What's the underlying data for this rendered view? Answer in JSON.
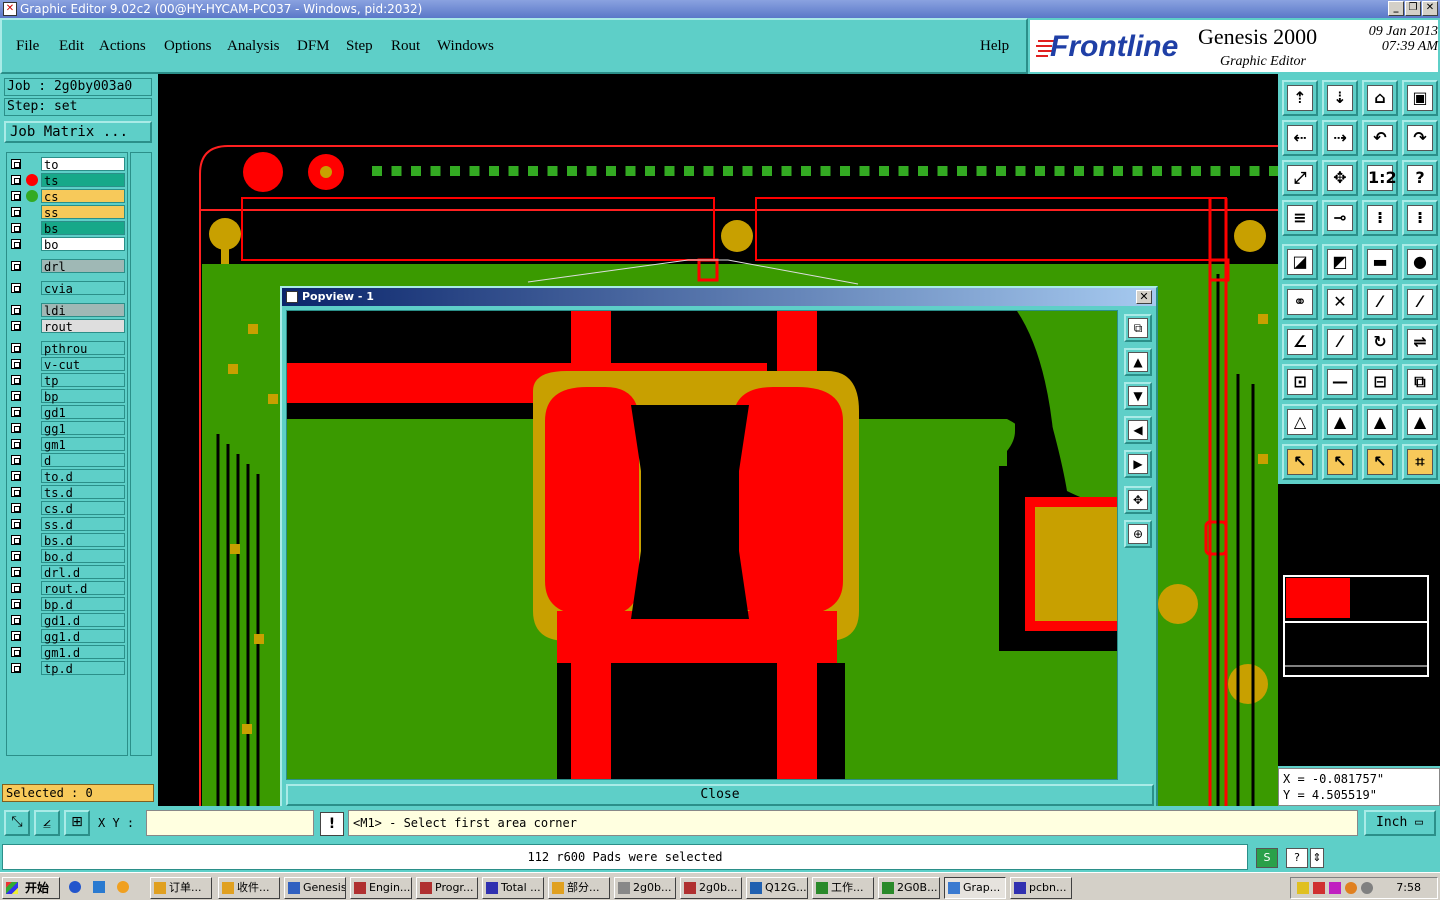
{
  "window": {
    "title": "Graphic Editor 9.02c2 (00@HY-HYCAM-PC037 - Windows, pid:2032)",
    "controls": [
      "_",
      "❐",
      "✕"
    ]
  },
  "menu": {
    "items": [
      "File",
      "Edit",
      "Actions",
      "Options",
      "Analysis",
      "DFM",
      "Step",
      "Rout",
      "Windows"
    ],
    "help": "Help"
  },
  "logo": {
    "brand": "Frontline",
    "product": "Genesis 2000",
    "subtitle": "Graphic Editor",
    "date": "09 Jan 2013",
    "time": "07:39 AM"
  },
  "job": {
    "job_label": "Job  : 2g0by003a0",
    "step_label": "Step: set",
    "matrix_button": "Job Matrix ..."
  },
  "layers": [
    {
      "name": "to",
      "bg": "#ffffff",
      "dot": ""
    },
    {
      "name": "ts",
      "bg": "#17a889",
      "dot": "#ff0000"
    },
    {
      "name": "cs",
      "bg": "#f7c95a",
      "dot": "#33aa22"
    },
    {
      "name": "ss",
      "bg": "#f7c95a",
      "dot": ""
    },
    {
      "name": "bs",
      "bg": "#17a889",
      "dot": ""
    },
    {
      "name": "bo",
      "bg": "#ffffff",
      "dot": ""
    },
    {
      "name": "drl",
      "bg": "#9fb8b5",
      "dot": ""
    },
    {
      "name": "cvia",
      "bg": "#5ecfc8",
      "dot": ""
    },
    {
      "name": "ldi",
      "bg": "#9fb8b5",
      "dot": ""
    },
    {
      "name": "rout",
      "bg": "#dedede",
      "dot": ""
    },
    {
      "name": "pthrou",
      "bg": "#5ecfc8",
      "dot": ""
    },
    {
      "name": "v-cut",
      "bg": "#5ecfc8",
      "dot": ""
    },
    {
      "name": "tp",
      "bg": "#5ecfc8",
      "dot": ""
    },
    {
      "name": "bp",
      "bg": "#5ecfc8",
      "dot": ""
    },
    {
      "name": "gd1",
      "bg": "#5ecfc8",
      "dot": ""
    },
    {
      "name": "gg1",
      "bg": "#5ecfc8",
      "dot": ""
    },
    {
      "name": "gm1",
      "bg": "#5ecfc8",
      "dot": ""
    },
    {
      "name": "d",
      "bg": "#5ecfc8",
      "dot": ""
    },
    {
      "name": "to.d",
      "bg": "#5ecfc8",
      "dot": ""
    },
    {
      "name": "ts.d",
      "bg": "#5ecfc8",
      "dot": ""
    },
    {
      "name": "cs.d",
      "bg": "#5ecfc8",
      "dot": ""
    },
    {
      "name": "ss.d",
      "bg": "#5ecfc8",
      "dot": ""
    },
    {
      "name": "bs.d",
      "bg": "#5ecfc8",
      "dot": ""
    },
    {
      "name": "bo.d",
      "bg": "#5ecfc8",
      "dot": ""
    },
    {
      "name": "drl.d",
      "bg": "#5ecfc8",
      "dot": ""
    },
    {
      "name": "rout.d",
      "bg": "#5ecfc8",
      "dot": ""
    },
    {
      "name": "bp.d",
      "bg": "#5ecfc8",
      "dot": ""
    },
    {
      "name": "gd1.d",
      "bg": "#5ecfc8",
      "dot": ""
    },
    {
      "name": "gg1.d",
      "bg": "#5ecfc8",
      "dot": ""
    },
    {
      "name": "gm1.d",
      "bg": "#5ecfc8",
      "dot": ""
    },
    {
      "name": "tp.d",
      "bg": "#5ecfc8",
      "dot": ""
    }
  ],
  "selected": "Selected : 0",
  "popview": {
    "title": "Popview - 1",
    "close_button": "Close"
  },
  "coords": {
    "x": "X = -0.081757\"",
    "y": "Y = 4.505519\""
  },
  "command": {
    "xy_label": "X Y :",
    "prompt": "<M1> - Select first area corner",
    "units": "Inch"
  },
  "status": {
    "message": "112 r600 Pads were selected"
  },
  "taskbar": {
    "start": "开始",
    "items": [
      "订单...",
      "收件...",
      "Genesis",
      "Engin...",
      "Progr...",
      "Total ...",
      "部分...",
      "2g0b...",
      "2g0b...",
      "Q12G...",
      "工作...",
      "2G0B...",
      "Grap...",
      "pcbn..."
    ],
    "clock": "7:58"
  },
  "colors": {
    "panel": "#5ecfc8",
    "copper_green": "#3a9a00",
    "trace_red": "#ff0000",
    "pad_gold": "#c8a000"
  }
}
